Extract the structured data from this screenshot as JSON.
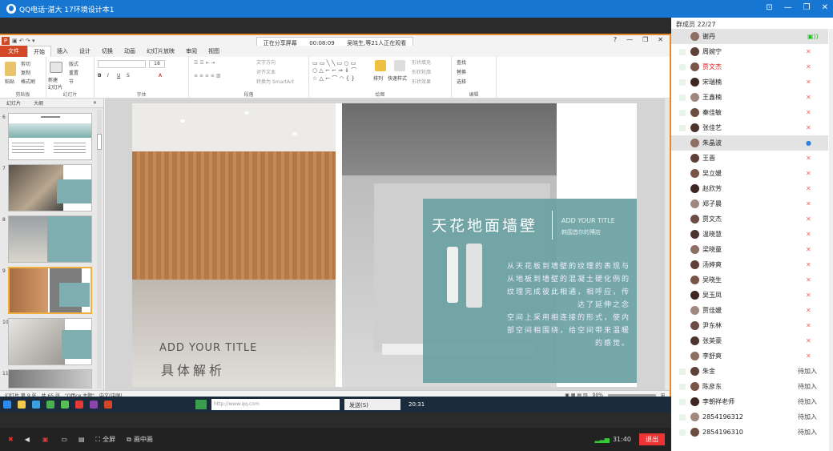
{
  "titlebar": {
    "app": "QQ电话",
    "sep": " - ",
    "group": "湛大 17环境设计本1"
  },
  "share": {
    "text": "正在分享屏幕",
    "time": "00:08:09",
    "viewers": "吴晓生,等21人正在观看"
  },
  "ppt": {
    "tabs": [
      "文件",
      "开始",
      "插入",
      "设计",
      "切换",
      "动画",
      "幻灯片放映",
      "审阅",
      "视图"
    ],
    "groups": [
      "剪贴板",
      "幻灯片",
      "字体",
      "段落",
      "绘图",
      "编辑"
    ],
    "ribbon_items": {
      "cut": "剪切",
      "copy": "复制",
      "painter": "格式刷",
      "paste": "粘贴",
      "new_slide": "新建\n幻灯片",
      "layout": "版式",
      "reset": "重置",
      "section": "节",
      "text_dir": "文字方向",
      "align_text": "对齐文本",
      "smartart": "转换为 SmartArt",
      "arrange": "排列",
      "quick_style": "快速样式",
      "fill": "形状填充",
      "outline": "形状轮廓",
      "effect": "形状效果",
      "find": "查找",
      "replace": "替换",
      "select": "选择"
    },
    "thumb_tabs": [
      "幻灯片",
      "大纲"
    ],
    "slide_numbers": [
      "6",
      "7",
      "8",
      "9",
      "10",
      "11"
    ],
    "slide": {
      "left_title": "ADD YOUR TITLE",
      "left_sub": "具体解析",
      "right_title": "天花地面墙壁",
      "right_en": "ADD YOUR TITLE",
      "right_en_sub": "韩国首尔的博店",
      "body": [
        "从天花板到墙壁的纹理的表现与",
        "从地板到墙壁的混凝土硬化例的",
        "纹理完成彼此相通，相呼应，传",
        "达了延伸之念",
        "空间上采用相连接的形式，使内",
        "部空间相围绕，给空间带来温暖",
        "的感觉。"
      ]
    },
    "status": {
      "slide": "幻灯片 第 9 张，共 65 张",
      "theme": "\"Office 主题\"",
      "lang": "中文(中国)",
      "zoom": "90%"
    }
  },
  "taskbar": {
    "url": "http://www.qq.com",
    "send": "发送(S)",
    "time": "20:31"
  },
  "bottombar": {
    "fullscreen": "全屏",
    "pip": "画中画",
    "duration": "31:40",
    "hangup": "退出"
  },
  "members": {
    "header": "群成员 22/27",
    "list": [
      {
        "name": "谢丹",
        "color": "#222",
        "state": "speaking"
      },
      {
        "name": "周婉宁",
        "color": "#222",
        "state": "muted"
      },
      {
        "name": "贾文杰",
        "color": "#e02020",
        "state": "muted"
      },
      {
        "name": "宋瑞楠",
        "color": "#222",
        "state": "muted"
      },
      {
        "name": "王鑫楠",
        "color": "#222",
        "state": "muted"
      },
      {
        "name": "秦佳敏",
        "color": "#222",
        "state": "muted"
      },
      {
        "name": "张佳艺",
        "color": "#222",
        "state": "muted"
      },
      {
        "name": "朱晶波",
        "color": "#222",
        "state": "mic"
      },
      {
        "name": "王晋",
        "color": "#222",
        "state": "muted"
      },
      {
        "name": "吴立媛",
        "color": "#222",
        "state": "muted"
      },
      {
        "name": "赵欣芳",
        "color": "#222",
        "state": "muted"
      },
      {
        "name": "郑子晨",
        "color": "#222",
        "state": "muted"
      },
      {
        "name": "贾文杰",
        "color": "#222",
        "state": "muted"
      },
      {
        "name": "温晓慧",
        "color": "#222",
        "state": "muted"
      },
      {
        "name": "梁晓童",
        "color": "#222",
        "state": "muted"
      },
      {
        "name": "汤婷爽",
        "color": "#222",
        "state": "muted"
      },
      {
        "name": "吴晓生",
        "color": "#222",
        "state": "muted"
      },
      {
        "name": "吴玉凤",
        "color": "#222",
        "state": "muted"
      },
      {
        "name": "贾佳媛",
        "color": "#222",
        "state": "muted"
      },
      {
        "name": "尹东林",
        "color": "#222",
        "state": "muted"
      },
      {
        "name": "张英豪",
        "color": "#222",
        "state": "muted"
      },
      {
        "name": "李舒爽",
        "color": "#222",
        "state": "muted"
      },
      {
        "name": "朱金",
        "color": "#222",
        "state": "pending",
        "label": "待加入"
      },
      {
        "name": "陈彦东",
        "color": "#222",
        "state": "pending",
        "label": "待加入"
      },
      {
        "name": "李朝祥老师",
        "color": "#222",
        "state": "pending",
        "label": "待加入"
      },
      {
        "name": "2854196312",
        "color": "#222",
        "state": "pending",
        "label": "待加入"
      },
      {
        "name": "2854196310",
        "color": "#222",
        "state": "pending",
        "label": "待加入"
      }
    ]
  }
}
